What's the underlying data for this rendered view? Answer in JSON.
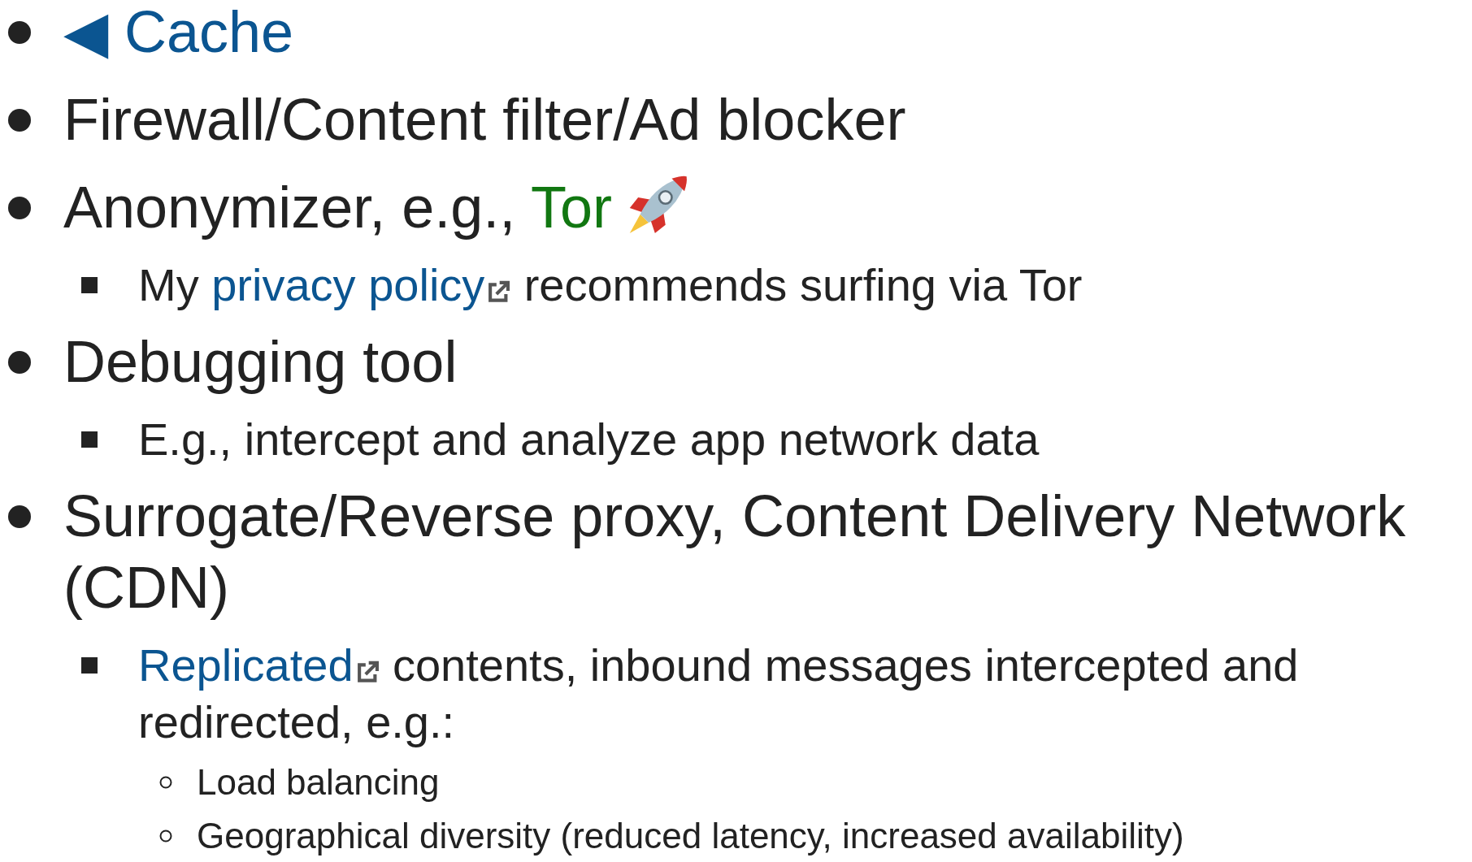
{
  "items": [
    {
      "parts": [
        {
          "kind": "link",
          "text": "◀ Cache"
        }
      ]
    },
    {
      "parts": [
        {
          "kind": "text",
          "text": "Firewall/Content filter/Ad blocker"
        }
      ]
    },
    {
      "parts": [
        {
          "kind": "text",
          "text": "Anonymizer, e.g., "
        },
        {
          "kind": "visited_link",
          "text": "Tor"
        },
        {
          "kind": "rocket"
        }
      ],
      "children": [
        {
          "parts": [
            {
              "kind": "text",
              "text": "My "
            },
            {
              "kind": "external_link",
              "text": "privacy policy"
            },
            {
              "kind": "text",
              "text": " recommends surfing via Tor"
            }
          ]
        }
      ]
    },
    {
      "parts": [
        {
          "kind": "text",
          "text": "Debugging tool"
        }
      ],
      "children": [
        {
          "parts": [
            {
              "kind": "text",
              "text": "E.g., intercept and analyze app network data"
            }
          ]
        }
      ]
    },
    {
      "parts": [
        {
          "kind": "text",
          "text": "Surrogate/Reverse proxy, Content Delivery Network (CDN)"
        }
      ],
      "children": [
        {
          "parts": [
            {
              "kind": "external_link",
              "text": "Replicated"
            },
            {
              "kind": "text",
              "text": " contents, inbound messages intercepted and redirected, e.g.:"
            }
          ],
          "children": [
            {
              "parts": [
                {
                  "kind": "text",
                  "text": "Load balancing"
                }
              ]
            },
            {
              "parts": [
                {
                  "kind": "text",
                  "text": "Geographical diversity (reduced latency, increased availability)"
                }
              ]
            }
          ]
        }
      ]
    }
  ]
}
